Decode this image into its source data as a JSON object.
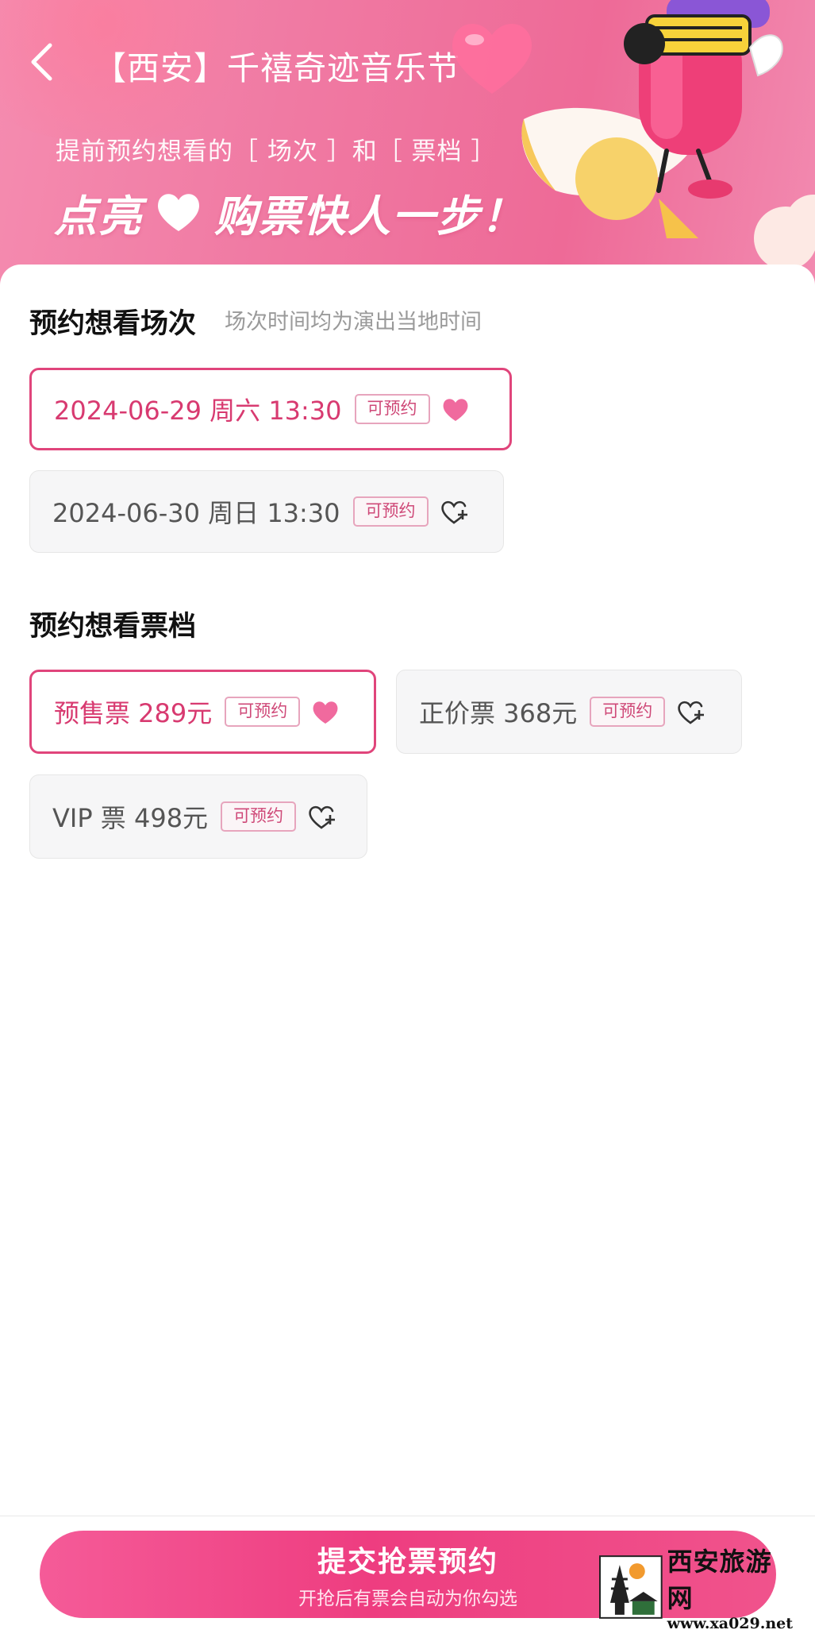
{
  "header": {
    "title": "【西安】千禧奇迹音乐节",
    "subtitle": "提前预约想看的［ 场次 ］和［ 票档 ］",
    "slogan_left": "点亮",
    "slogan_right": "购票快人一步！"
  },
  "sessions": {
    "title": "预约想看场次",
    "hint": "场次时间均为演出当地时间",
    "items": [
      {
        "label": "2024-06-29  周六 13:30",
        "badge": "可预约",
        "selected": true
      },
      {
        "label": "2024-06-30 周日 13:30",
        "badge": "可预约",
        "selected": false
      }
    ]
  },
  "tickets": {
    "title": "预约想看票档",
    "items": [
      {
        "label": "预售票 289元",
        "badge": "可预约",
        "selected": true
      },
      {
        "label": "正价票 368元",
        "badge": "可预约",
        "selected": false
      },
      {
        "label": "VIP 票 498元",
        "badge": "可预约",
        "selected": false
      }
    ]
  },
  "submit": {
    "label": "提交抢票预约",
    "sublabel": "开抢后有票会自动为你勾选"
  },
  "watermark": {
    "name": "西安旅游网",
    "url": "www.xa029.net"
  },
  "colors": {
    "accent": "#e0457b",
    "banner": "#ef7aa5",
    "button": "#ee3d80"
  },
  "icons": {
    "back": "chevron-left-icon",
    "selected": "heart-filled-icon",
    "unselected": "heart-plus-icon"
  }
}
